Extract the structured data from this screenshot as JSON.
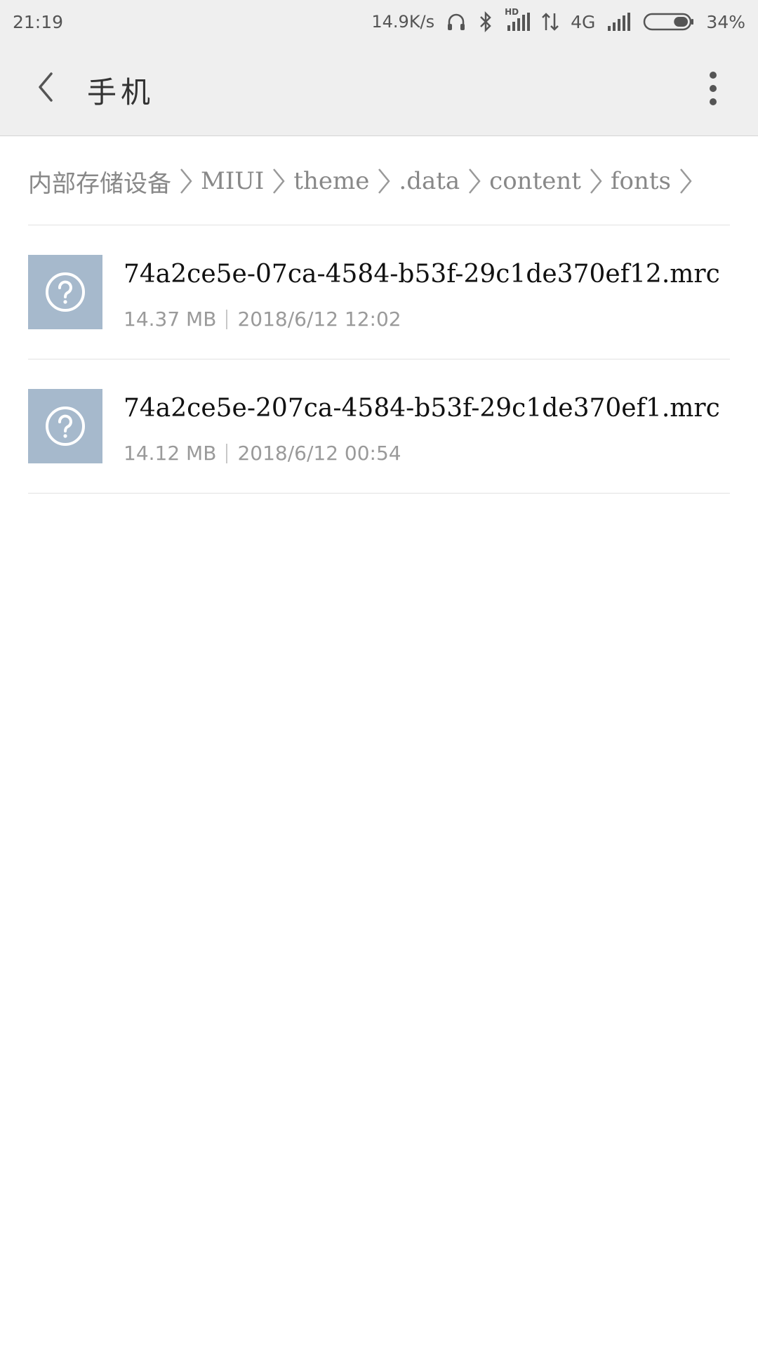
{
  "status_bar": {
    "time": "21:19",
    "network_speed": "14.9K/s",
    "network_type": "4G",
    "hd_label": "HD",
    "battery_percent": "34%",
    "battery_level": 0.34,
    "icons": [
      "headphones-icon",
      "bluetooth-icon",
      "hd-signal-icon",
      "data-arrows-icon",
      "signal-icon",
      "battery-icon"
    ]
  },
  "header": {
    "title": "手机",
    "back_icon": "chevron-left-icon",
    "menu_icon": "more-vertical-icon"
  },
  "breadcrumb": {
    "items": [
      "内部存储设备",
      "MIUI",
      "theme",
      ".data",
      "content",
      "fonts"
    ],
    "separator_icon": "chevron-right-icon"
  },
  "files": [
    {
      "name": "74a2ce5e-07ca-4584-b53f-29c1de370ef12.mrc",
      "size": "14.37 MB",
      "date": "2018/6/12 12:02",
      "icon": "unknown-file-icon"
    },
    {
      "name": "74a2ce5e-207ca-4584-b53f-29c1de370ef1.mrc",
      "size": "14.12 MB",
      "date": "2018/6/12 00:54",
      "icon": "unknown-file-icon"
    }
  ],
  "colors": {
    "header_bg": "#efefef",
    "file_icon_bg": "#a6b9cc",
    "meta_text": "#9a9a9a",
    "breadcrumb_text": "#888888"
  }
}
